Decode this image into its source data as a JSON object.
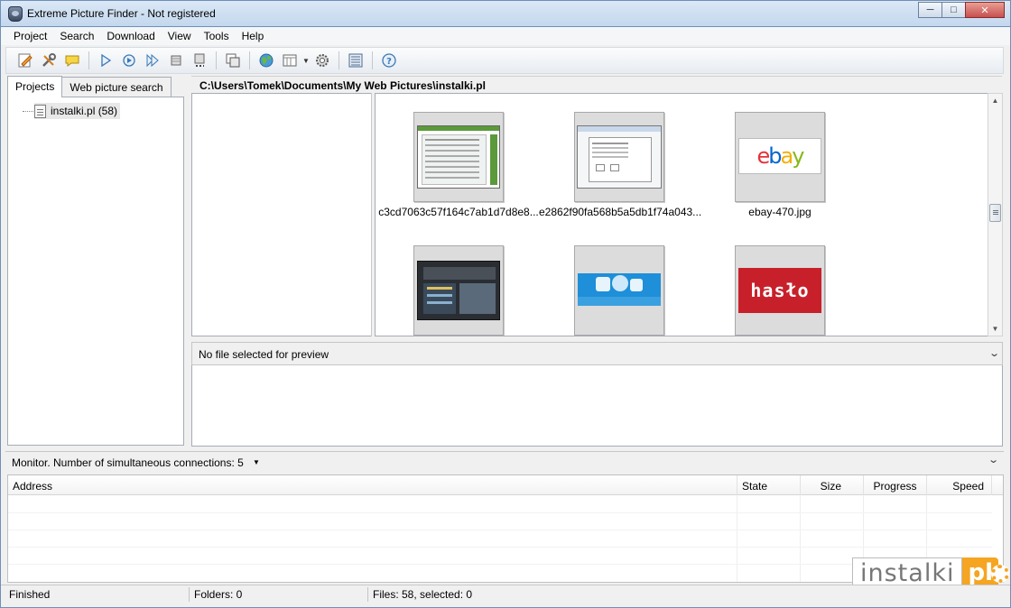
{
  "window": {
    "title": "Extreme Picture Finder - Not registered",
    "minimize": "0",
    "maximize": "1",
    "close": "r"
  },
  "menu": [
    "Project",
    "Search",
    "Download",
    "View",
    "Tools",
    "Help"
  ],
  "toolbar": {
    "icons": [
      "edit-project-icon",
      "project-settings-icon",
      "comment-icon",
      "start-icon",
      "refresh-icon",
      "resume-icon",
      "stop-icon",
      "stop-all-icon",
      "copy-icon",
      "globe-icon",
      "view-mode-icon",
      "settings-icon",
      "thumbnails-icon",
      "help-icon"
    ]
  },
  "left_panel": {
    "tabs": [
      "Projects",
      "Web picture search"
    ],
    "active_tab": "Projects",
    "tree": [
      {
        "label": "instalki.pl (58)"
      }
    ]
  },
  "path": "C:\\Users\\Tomek\\Documents\\My Web Pictures\\instalki.pl",
  "thumbnails": [
    {
      "name": "c3cd7063c57f164c7ab1d7d8e8...",
      "content": "screenshot-dialog"
    },
    {
      "name": "e2862f90fa568b5a5db1f74a043...",
      "content": "screenshot-window"
    },
    {
      "name": "ebay-470.jpg",
      "content": "ebay-logo",
      "logo_text": "ebay"
    },
    {
      "name": "",
      "content": "dark-ui"
    },
    {
      "name": "",
      "content": "blue-banner"
    },
    {
      "name": "",
      "content": "haslo-banner",
      "logo_text": "hasło"
    }
  ],
  "preview": {
    "text": "No file selected for preview"
  },
  "monitor": {
    "text": "Monitor. Number of simultaneous connections: 5",
    "columns": [
      "Address",
      "State",
      "Size",
      "Progress",
      "Speed"
    ],
    "rows": []
  },
  "status": {
    "state": "Finished",
    "folders": "Folders: 0",
    "files": "Files: 58, selected: 0"
  },
  "watermark": {
    "text": "instalki",
    "suffix": "pl"
  },
  "colors": {
    "ebay_red": "#e53238",
    "ebay_blue": "#0064d2",
    "ebay_yellow": "#f5af02",
    "ebay_green": "#86b817",
    "haslo_bg": "#c8202a",
    "watermark_orange": "#f5a521"
  }
}
